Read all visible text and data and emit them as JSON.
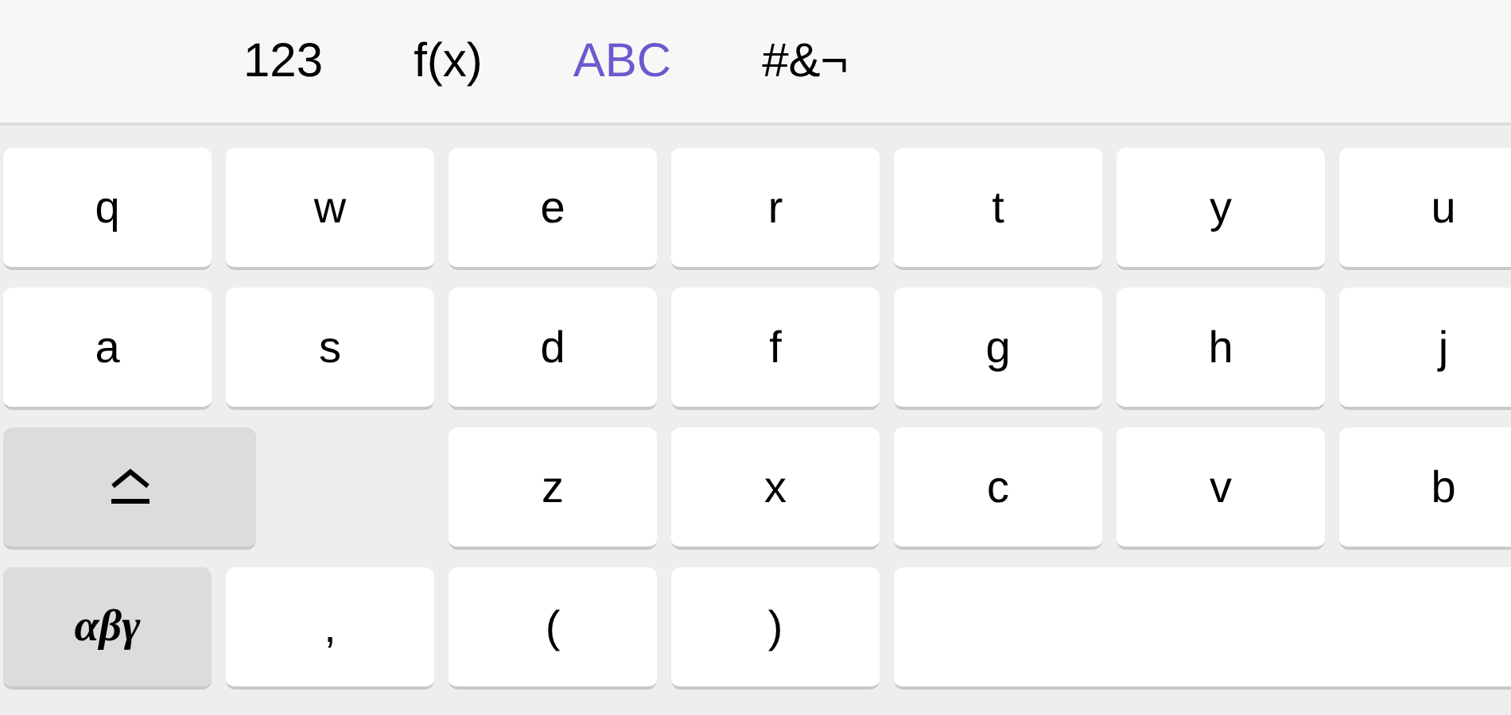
{
  "tabs": [
    {
      "label": "123",
      "selected": false
    },
    {
      "label": "f(x)",
      "selected": false
    },
    {
      "label": "ABC",
      "selected": true
    },
    {
      "label": "#&¬",
      "selected": false
    }
  ],
  "rows": [
    [
      {
        "kind": "char",
        "label": "q"
      },
      {
        "kind": "char",
        "label": "w"
      },
      {
        "kind": "char",
        "label": "e"
      },
      {
        "kind": "char",
        "label": "r"
      },
      {
        "kind": "char",
        "label": "t"
      },
      {
        "kind": "char",
        "label": "y"
      },
      {
        "kind": "char",
        "label": "u"
      }
    ],
    [
      {
        "kind": "char",
        "label": "a"
      },
      {
        "kind": "char",
        "label": "s"
      },
      {
        "kind": "char",
        "label": "d"
      },
      {
        "kind": "char",
        "label": "f"
      },
      {
        "kind": "char",
        "label": "g"
      },
      {
        "kind": "char",
        "label": "h"
      },
      {
        "kind": "char",
        "label": "j"
      }
    ],
    [
      {
        "kind": "shift"
      },
      {
        "kind": "char",
        "label": "z"
      },
      {
        "kind": "char",
        "label": "x"
      },
      {
        "kind": "char",
        "label": "c"
      },
      {
        "kind": "char",
        "label": "v"
      },
      {
        "kind": "char",
        "label": "b"
      }
    ],
    [
      {
        "kind": "greek",
        "label": "αβγ"
      },
      {
        "kind": "char",
        "label": ","
      },
      {
        "kind": "char",
        "label": "("
      },
      {
        "kind": "char",
        "label": ")"
      },
      {
        "kind": "space"
      }
    ]
  ]
}
